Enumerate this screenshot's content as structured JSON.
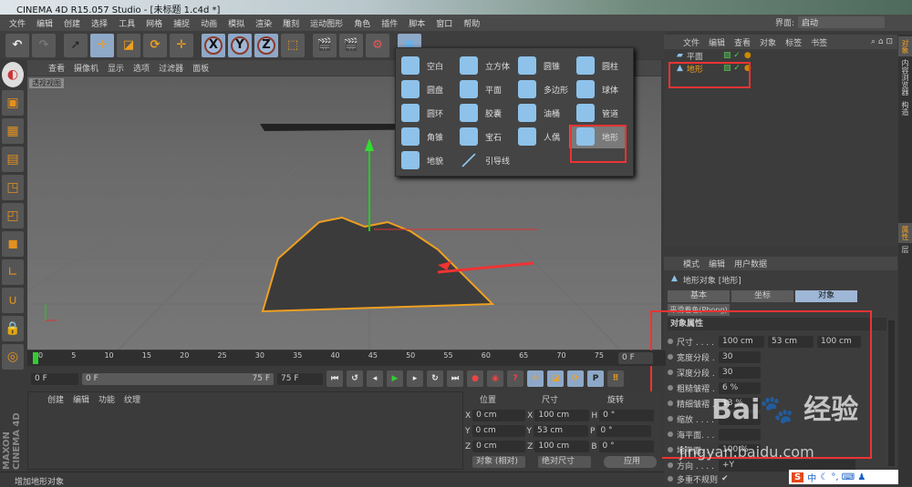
{
  "title": "CINEMA 4D R15.057 Studio - [未标题 1.c4d *]",
  "menu": [
    "文件",
    "编辑",
    "创建",
    "选择",
    "工具",
    "网格",
    "捕捉",
    "动画",
    "模拟",
    "渲染",
    "雕刻",
    "运动图形",
    "角色",
    "插件",
    "脚本",
    "窗口",
    "帮助"
  ],
  "interface": {
    "label": "界面:",
    "value": "启动"
  },
  "viewport": {
    "menu": [
      "查看",
      "摄像机",
      "显示",
      "选项",
      "过滤器",
      "面板"
    ],
    "label": "透视视图"
  },
  "popup": {
    "items": [
      "空白",
      "立方体",
      "圆锥",
      "圆柱",
      "圆盘",
      "平面",
      "多边形",
      "球体",
      "圆环",
      "胶囊",
      "油桶",
      "管道",
      "角锥",
      "宝石",
      "人偶",
      "地形",
      "地貌",
      "引导线"
    ],
    "highlight": "地形"
  },
  "object_manager": {
    "menu": [
      "文件",
      "编辑",
      "查看",
      "对象",
      "标签",
      "书签"
    ],
    "objects": [
      "平面",
      "地形"
    ]
  },
  "attributes": {
    "menu": [
      "模式",
      "编辑",
      "用户数据"
    ],
    "object_title": "地形对象 [地形]",
    "tabs": [
      "基本",
      "坐标",
      "对象"
    ],
    "phong": "平滑着色(Phong)",
    "section": "对象属性",
    "props": [
      {
        "label": "尺寸 . . . . .",
        "values": [
          "100 cm",
          "53 cm",
          "100 cm"
        ]
      },
      {
        "label": "宽度分段 . .",
        "values": [
          "30"
        ]
      },
      {
        "label": "深度分段 . .",
        "values": [
          "30"
        ]
      },
      {
        "label": "粗糙皱褶 . .",
        "values": [
          "6 %"
        ]
      },
      {
        "label": "精细皱褶 . .",
        "values": [
          "13 %"
        ]
      },
      {
        "label": "缩放 . . . .",
        "values": [
          ""
        ]
      },
      {
        "label": "海平面. . .",
        "values": [
          ""
        ]
      },
      {
        "label": "地平面. . .",
        "values": [
          "100 %"
        ]
      },
      {
        "label": "方向 . . . .",
        "values": [
          "+Y"
        ]
      },
      {
        "label": "多重不规则",
        "values": [
          "✔"
        ]
      }
    ]
  },
  "side_tabs": [
    "对象",
    "内容浏览器",
    "构造",
    "属性",
    "层"
  ],
  "timeline": {
    "ticks": [
      "0",
      "5",
      "10",
      "15",
      "20",
      "25",
      "30",
      "35",
      "40",
      "45",
      "50",
      "55",
      "60",
      "65",
      "70",
      "75"
    ],
    "current": "0 F",
    "start": "0 F",
    "range_start": "0 F",
    "range_end": "75 F",
    "end": "75 F"
  },
  "material_manager": {
    "menu": [
      "创建",
      "编辑",
      "功能",
      "纹理"
    ]
  },
  "coordinates": {
    "headers": [
      "位置",
      "尺寸",
      "旋转"
    ],
    "rows": [
      {
        "a": "X",
        "pos": "0 cm",
        "b": "X",
        "size": "100 cm",
        "c": "H",
        "rot": "0 °"
      },
      {
        "a": "Y",
        "pos": "0 cm",
        "b": "Y",
        "size": "53 cm",
        "c": "P",
        "rot": "0 °"
      },
      {
        "a": "Z",
        "pos": "0 cm",
        "b": "Z",
        "size": "100 cm",
        "c": "B",
        "rot": "0 °"
      }
    ],
    "mode": "对象 (相对)",
    "size_mode": "绝对尺寸",
    "apply": "应用"
  },
  "brand": "MAXON CINEMA 4D",
  "status": "增加地形对象",
  "ime": "中",
  "watermark": {
    "logo": "Bai du 经验",
    "url": "jingyan.baidu.com"
  }
}
